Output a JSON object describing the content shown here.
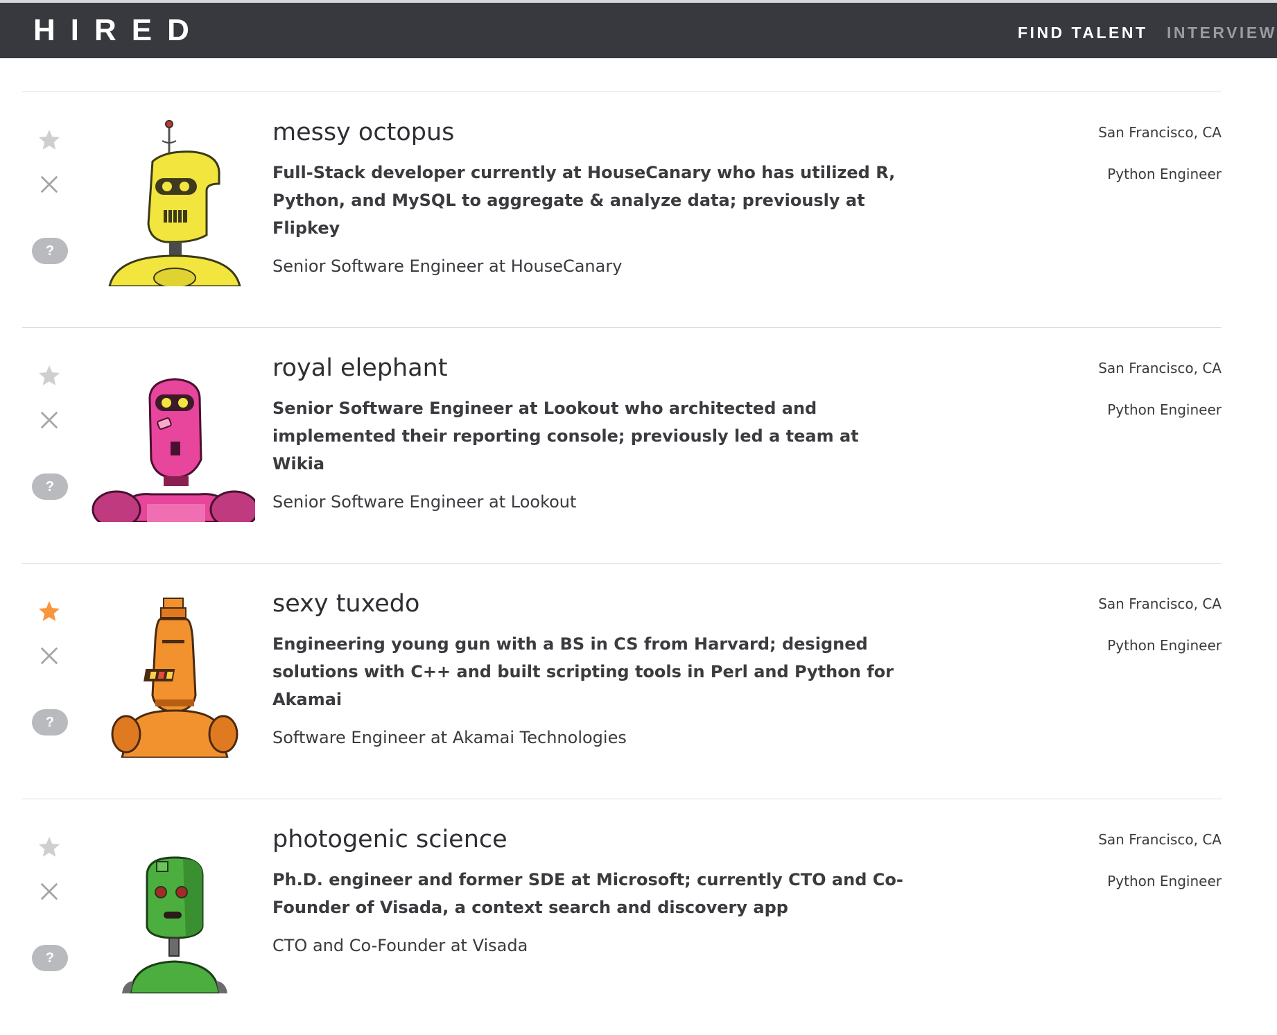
{
  "header": {
    "brand": "HIRED",
    "nav": [
      {
        "label": "FIND TALENT",
        "active": true
      },
      {
        "label": "INTERVIEWS",
        "active": false
      }
    ]
  },
  "colors": {
    "navbar_bg": "#38393e",
    "star_active": "#f7963c",
    "star_inactive": "#cfcfd1",
    "question_badge": "#b9babd"
  },
  "action_labels": {
    "question": "?"
  },
  "candidates": [
    {
      "name": "messy octopus",
      "summary": "Full-Stack developer currently at HouseCanary who has utilized R, Python, and MySQL to aggregate & analyze data; previously at Flipkey",
      "current": "Senior Software Engineer at HouseCanary",
      "location": "San Francisco, CA",
      "role": "Python Engineer",
      "starred": false,
      "avatar_icon": "yellow-robot-avatar",
      "avatar_color": "#f2e53d"
    },
    {
      "name": "royal elephant",
      "summary": "Senior Software Engineer at Lookout who architected and implemented their reporting console; previously led a team at Wikia",
      "current": "Senior Software Engineer at Lookout",
      "location": "San Francisco, CA",
      "role": "Python Engineer",
      "starred": false,
      "avatar_icon": "pink-robot-avatar",
      "avatar_color": "#e8459c"
    },
    {
      "name": "sexy tuxedo",
      "summary": "Engineering young gun with a BS in CS from Harvard; designed solutions with C++ and built scripting tools in Perl and Python for Akamai",
      "current": "Software Engineer at Akamai Technologies",
      "location": "San Francisco, CA",
      "role": "Python Engineer",
      "starred": true,
      "avatar_icon": "orange-robot-avatar",
      "avatar_color": "#f2922e"
    },
    {
      "name": "photogenic science",
      "summary": "Ph.D. engineer and former SDE at Microsoft; currently CTO and Co-Founder of Visada, a context search and discovery app",
      "current": "CTO and Co-Founder at Visada",
      "location": "San Francisco, CA",
      "role": "Python Engineer",
      "starred": false,
      "avatar_icon": "green-robot-avatar",
      "avatar_color": "#4cae3f"
    }
  ]
}
